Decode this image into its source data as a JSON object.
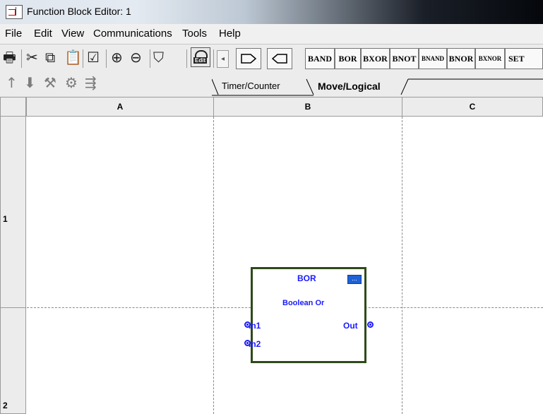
{
  "window": {
    "title": "Function Block Editor: 1"
  },
  "menu": [
    "File",
    "Edit",
    "View",
    "Communications",
    "Tools",
    "Help"
  ],
  "toolbar": {
    "function_buttons": [
      "BAND",
      "BOR",
      "BXOR",
      "BNOT",
      "BNAND",
      "BNOR",
      "BXNOR",
      "SET"
    ]
  },
  "tabs": [
    {
      "label": "Timer/Counter",
      "active": false
    },
    {
      "label": "Move/Logical",
      "active": true
    }
  ],
  "grid": {
    "columns": [
      "A",
      "B",
      "C"
    ],
    "rows": [
      "1",
      "2"
    ]
  },
  "block": {
    "name": "BOR",
    "description": "Boolean Or",
    "inputs": [
      "In1",
      "In2"
    ],
    "output": "Out",
    "config_icon": "..."
  },
  "colors": {
    "block_text": "#1a1aff",
    "block_border": "#2e4a1a",
    "config_button": "#1e62d6"
  }
}
